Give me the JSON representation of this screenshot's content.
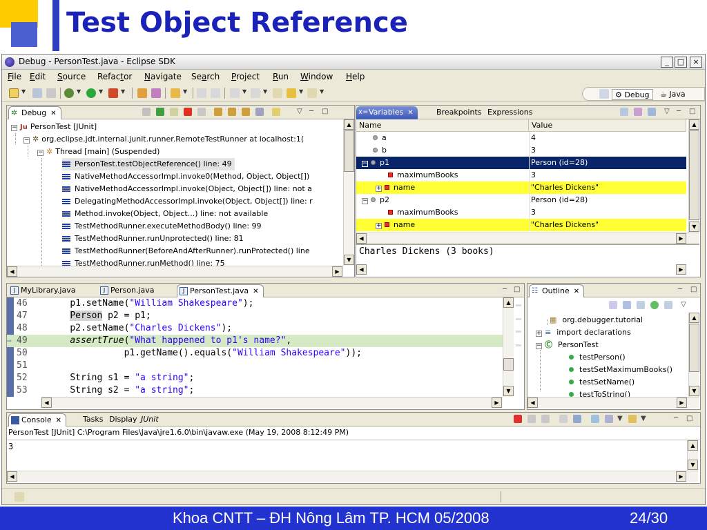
{
  "slide": {
    "title": "Test Object Reference",
    "footer": "Khoa CNTT – ĐH Nông Lâm TP. HCM 05/2008",
    "page": "24/30",
    "colors": {
      "title": "#1a22b8",
      "footer_bg": "#2233d0",
      "accent_yellow": "#ffcc00"
    }
  },
  "window": {
    "title": "Debug - PersonTest.java - Eclipse SDK",
    "controls": {
      "minimize": "_",
      "maximize": "□",
      "close": "×"
    }
  },
  "menu": [
    {
      "pre": "",
      "u": "F",
      "post": "ile"
    },
    {
      "pre": "",
      "u": "E",
      "post": "dit"
    },
    {
      "pre": "",
      "u": "S",
      "post": "ource"
    },
    {
      "pre": "Refac",
      "u": "t",
      "post": "or"
    },
    {
      "pre": "",
      "u": "N",
      "post": "avigate"
    },
    {
      "pre": "Se",
      "u": "a",
      "post": "rch"
    },
    {
      "pre": "",
      "u": "P",
      "post": "roject"
    },
    {
      "pre": "",
      "u": "R",
      "post": "un"
    },
    {
      "pre": "",
      "u": "W",
      "post": "indow"
    },
    {
      "pre": "",
      "u": "H",
      "post": "elp"
    }
  ],
  "perspectives": {
    "debug": "Debug",
    "java": "Java"
  },
  "debug_view": {
    "tab": "Debug",
    "tree": [
      "PersonTest [JUnit]",
      "org.eclipse.jdt.internal.junit.runner.RemoteTestRunner at localhost:1(",
      "Thread [main] (Suspended)",
      "PersonTest.testObjectReference() line: 49",
      "NativeMethodAccessorImpl.invoke0(Method, Object, Object[])",
      "NativeMethodAccessorImpl.invoke(Object, Object[]) line: not a",
      "DelegatingMethodAccessorImpl.invoke(Object, Object[]) line: r",
      "Method.invoke(Object, Object...) line: not available",
      "TestMethodRunner.executeMethodBody() line: 99",
      "TestMethodRunner.runUnprotected() line: 81",
      "TestMethodRunner(BeforeAndAfterRunner).runProtected() line",
      "TestMethodRunner.runMethod() line: 75"
    ]
  },
  "variables_view": {
    "tabs": [
      "Variables",
      "Breakpoints",
      "Expressions"
    ],
    "columns": [
      "Name",
      "Value"
    ],
    "rows": [
      {
        "name": "a",
        "value": "4"
      },
      {
        "name": "b",
        "value": "3"
      },
      {
        "name": "p1",
        "value": "Person  (id=28)"
      },
      {
        "name": "maximumBooks",
        "value": "3"
      },
      {
        "name": "name",
        "value": "\"Charles Dickens\""
      },
      {
        "name": "p2",
        "value": "Person  (id=28)"
      },
      {
        "name": "maximumBooks",
        "value": "3"
      },
      {
        "name": "name",
        "value": "\"Charles Dickens\""
      }
    ],
    "detail": "Charles Dickens (3 books)"
  },
  "editor": {
    "tabs": [
      "MyLibrary.java",
      "Person.java",
      "PersonTest.java"
    ],
    "lines": [
      {
        "num": "46",
        "a": "p1.setName(",
        "s": "\"William Shakespeare\"",
        "b": ");"
      },
      {
        "num": "47",
        "h": "Person",
        "a": " p2 = p1;",
        "s": "",
        "b": ""
      },
      {
        "num": "48",
        "a": "p2.setName(",
        "s": "\"Charles Dickens\"",
        "b": ");"
      },
      {
        "num": "49",
        "i": "assertTrue",
        "a": "(",
        "s": "\"What happened to p1's name?\"",
        "b": ","
      },
      {
        "num": "50",
        "a": "          p1.getName().equals(",
        "s": "\"William Shakespeare\"",
        "b": "));"
      },
      {
        "num": "51",
        "a": "",
        "s": "",
        "b": ""
      },
      {
        "num": "52",
        "a": "String s1 = ",
        "s": "\"a string\"",
        "b": ";"
      },
      {
        "num": "53",
        "a": "String s2 = ",
        "s": "\"a string\"",
        "b": ";"
      }
    ]
  },
  "outline": {
    "tab": "Outline",
    "items": [
      "org.debugger.tutorial",
      "import declarations",
      "PersonTest",
      "testPerson()",
      "testSetMaximumBooks()",
      "testSetName()",
      "testToString()"
    ]
  },
  "console": {
    "tabs": [
      "Console",
      "Tasks",
      "Display",
      "JUnit"
    ],
    "launch": "PersonTest [JUnit] C:\\Program Files\\Java\\jre1.6.0\\bin\\javaw.exe (May 19, 2008 8:12:49 PM)",
    "output": "3"
  }
}
